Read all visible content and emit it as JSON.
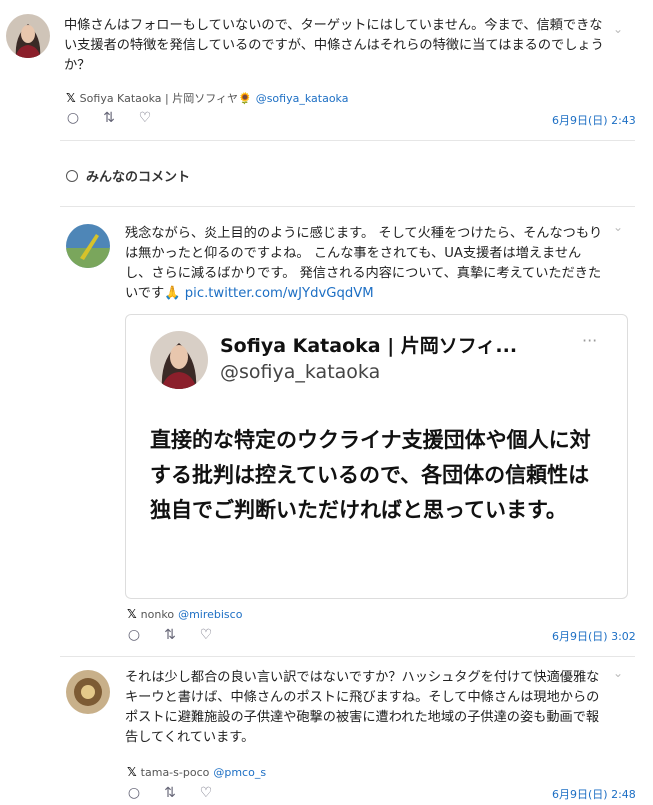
{
  "tweets": [
    {
      "text": "中條さんはフォローもしていないので、ターゲットにはしていません。今まで、信頼できない支援者の特徴を発信しているのですが、中條さんはそれらの特徴に当てはまるのでしょうか？",
      "x_mark": "𝕏",
      "name": "Sofiya Kataoka | 片岡ソフィヤ🌻",
      "handle": "@sofiya_kataoka",
      "time": "6月9日(日) 2:43"
    },
    {
      "text": "残念ながら、炎上目的のように感じます。 そして火種をつけたら、そんなつもりは無かったと仰るのですよね。 こんな事をされても、UA支援者は増えませんし、さらに減るばかりです。 発信される内容について、真摯に考えていただきたいです🙏 ",
      "link": "pic.twitter.com/wJYdvGqdVM",
      "x_mark": "𝕏",
      "name": "nonko",
      "handle": "@mirebisco",
      "time": "6月9日(日) 3:02"
    },
    {
      "text": "それは少し都合の良い言い訳ではないですか？ハッシュタグを付けて快適優雅なキーウと書けば、中條さんのポストに飛びますね。そして中條さんは現地からのポストに避難施設の子供達や砲撃の被害に遭われた地域の子供達の姿も動画で報告してくれています。",
      "x_mark": "𝕏",
      "name": "tama-s-poco",
      "handle": "@pmco_s",
      "time": "6月9日(日) 2:48"
    }
  ],
  "section": {
    "icon": "search-icon",
    "label": "みんなのコメント"
  },
  "embed": {
    "name": "Sofiya Kataoka | 片岡ソフィ...",
    "handle": "@sofiya_kataoka",
    "more": "···",
    "body": "直接的な特定のウクライナ支援団体や個人に対する批判は控えているので、各団体の信頼性は独自でご判断いただければと思っています。"
  },
  "icons": {
    "reply": "reply-icon",
    "retweet": "retweet-icon",
    "like": "heart-icon",
    "chevron": "chevron-down-icon"
  },
  "colors": {
    "link": "#1d6fc4",
    "divider": "#e6e6e6"
  }
}
